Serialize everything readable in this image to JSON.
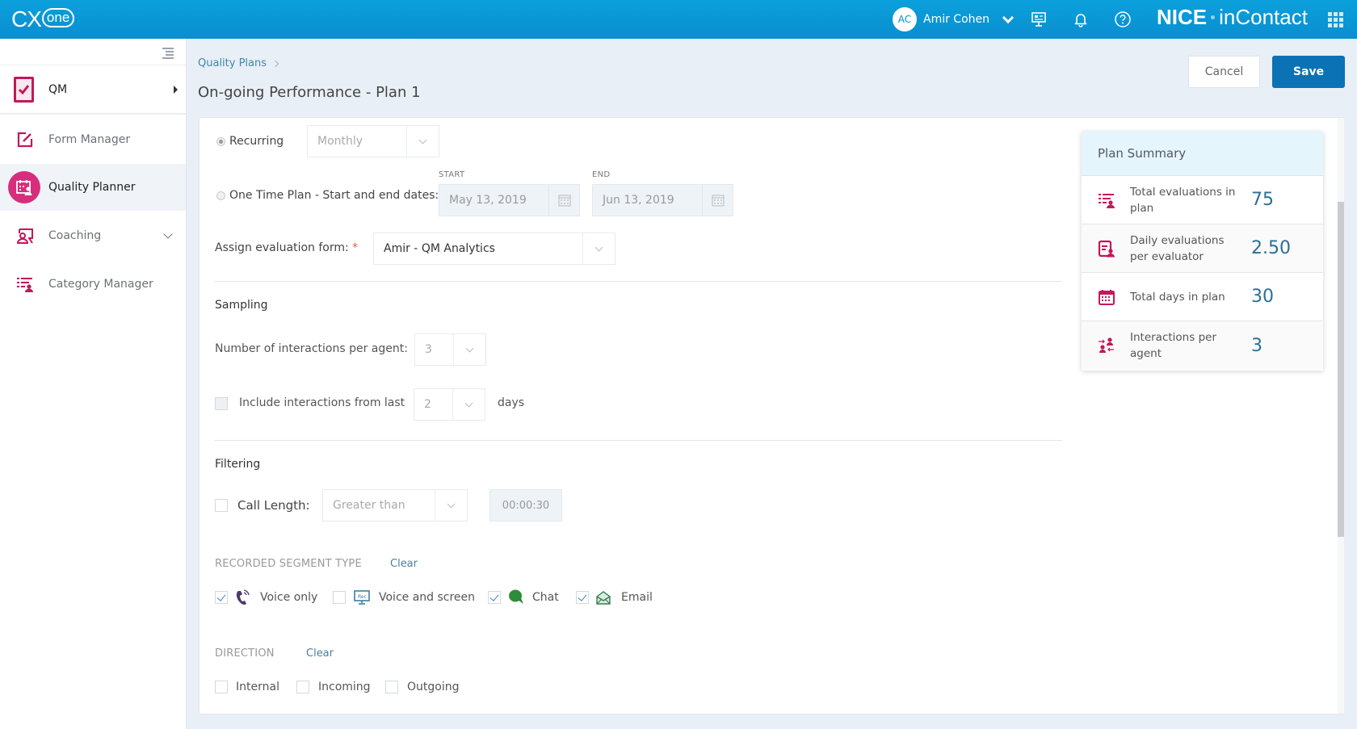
{
  "header": {
    "logo_main": "CX",
    "logo_sub": "one",
    "user_initials": "AC",
    "user_name": "Amir Cohen",
    "brand_left": "NICE",
    "brand_right": "inContact",
    "icons": [
      "presentation-icon",
      "bell-icon",
      "help-icon",
      "apps-grid-icon"
    ]
  },
  "sidebar": {
    "items": [
      {
        "label": "QM",
        "icon": "clipboard-check-icon"
      },
      {
        "label": "Form Manager",
        "icon": "edit-form-icon"
      },
      {
        "label": "Quality Planner",
        "icon": "calendar-person-icon",
        "active": true
      },
      {
        "label": "Coaching",
        "icon": "coaching-board-icon",
        "expandable": true
      },
      {
        "label": "Category Manager",
        "icon": "list-person-icon"
      }
    ]
  },
  "page": {
    "breadcrumb": "Quality Plans",
    "title": "On-going Performance - Plan 1",
    "cancel_label": "Cancel",
    "save_label": "Save"
  },
  "schedule": {
    "recurring_label": "Recurring",
    "recurring_checked": true,
    "recurring_value": "Monthly",
    "onetime_label": "One Time Plan - Start and end dates:",
    "start_label": "START",
    "end_label": "END",
    "start_date": "May 13, 2019",
    "end_date": "Jun 13, 2019",
    "assign_label": "Assign evaluation form:",
    "required_mark": "*",
    "assign_value": "Amir - QM Analytics"
  },
  "sampling": {
    "title": "Sampling",
    "per_agent_label": "Number of interactions per agent:",
    "per_agent_value": "3",
    "include_label": "Include interactions from last",
    "include_checked": false,
    "include_value": "2",
    "days_label": "days"
  },
  "filtering": {
    "title": "Filtering",
    "call_length_label": "Call Length:",
    "call_length_checked": false,
    "call_length_operator": "Greater than",
    "call_length_value": "00:00:30",
    "segment_title": "RECORDED SEGMENT TYPE",
    "segment_clear": "Clear",
    "segments": [
      {
        "label": "Voice only",
        "checked": true,
        "icon": "phone-icon"
      },
      {
        "label": "Voice and screen",
        "checked": false,
        "icon": "screen-recording-icon"
      },
      {
        "label": "Chat",
        "checked": true,
        "icon": "chat-icon"
      },
      {
        "label": "Email",
        "checked": true,
        "icon": "email-icon"
      }
    ],
    "direction_title": "DIRECTION",
    "direction_clear": "Clear",
    "directions": [
      {
        "label": "Internal",
        "checked": false
      },
      {
        "label": "Incoming",
        "checked": false
      },
      {
        "label": "Outgoing",
        "checked": false
      }
    ]
  },
  "summary": {
    "title": "Plan Summary",
    "rows": [
      {
        "label": "Total evaluations in plan",
        "value": "75",
        "icon": "list-person-icon"
      },
      {
        "label": "Daily evaluations per evaluator",
        "value": "2.50",
        "icon": "clipboard-person-icon"
      },
      {
        "label": "Total days in plan",
        "value": "30",
        "icon": "calendar-icon"
      },
      {
        "label": "Interactions per agent",
        "value": "3",
        "icon": "agents-exchange-icon"
      }
    ]
  },
  "colors": {
    "header_blue": "#0a8ed0",
    "accent_magenta": "#d62e7d",
    "primary_button": "#0b72b5",
    "value_blue": "#2b6f95"
  }
}
